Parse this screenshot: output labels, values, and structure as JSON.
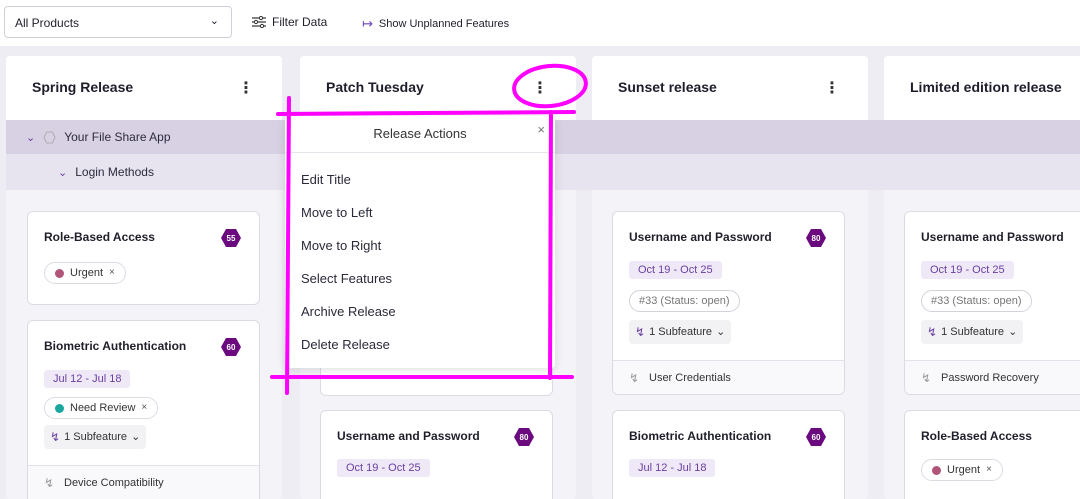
{
  "toolbar": {
    "product_select": "All Products",
    "filter_label": "Filter Data",
    "show_unplanned_label": "Show Unplanned Features"
  },
  "bands": {
    "app_label": "Your File Share App",
    "group_label": "Login Methods"
  },
  "columns": [
    {
      "title": "Spring Release",
      "cards": [
        {
          "title": "Role-Based Access",
          "score": "55",
          "tag": "Urgent"
        },
        {
          "title": "Biometric Authentication",
          "score": "60",
          "date": "Jul 12 - Jul 18",
          "tag": "Need Review",
          "subfeature": "1 Subfeature",
          "footer": "Device Compatibility"
        }
      ]
    },
    {
      "title": "Patch Tuesday",
      "cards": [
        {
          "title": "Username and Password",
          "score": "80",
          "date": "Oct 19 - Oct 25"
        }
      ]
    },
    {
      "title": "Sunset release",
      "cards": [
        {
          "title": "Username and Password",
          "score": "80",
          "date": "Oct 19 - Oct 25",
          "status": "#33 (Status: open)",
          "subfeature": "1 Subfeature",
          "footer": "User Credentials"
        },
        {
          "title": "Biometric Authentication",
          "score": "60",
          "date": "Jul 12 - Jul 18"
        }
      ]
    },
    {
      "title": "Limited edition release",
      "cards": [
        {
          "title": "Username and Password",
          "date": "Oct 19 - Oct 25",
          "status": "#33 (Status: open)",
          "subfeature": "1 Subfeature",
          "footer": "Password Recovery"
        },
        {
          "title": "Role-Based Access",
          "tag": "Urgent"
        }
      ]
    }
  ],
  "popup": {
    "title": "Release Actions",
    "items": [
      "Edit Title",
      "Move to Left",
      "Move to Right",
      "Select Features",
      "Archive Release",
      "Delete Release"
    ]
  },
  "colors": {
    "accent": "#6b3fa0",
    "score_badge": "#6a0a7e",
    "annotation": "#ff00ff",
    "urgent": "#b0547a",
    "need_review": "#1ba7a0"
  }
}
